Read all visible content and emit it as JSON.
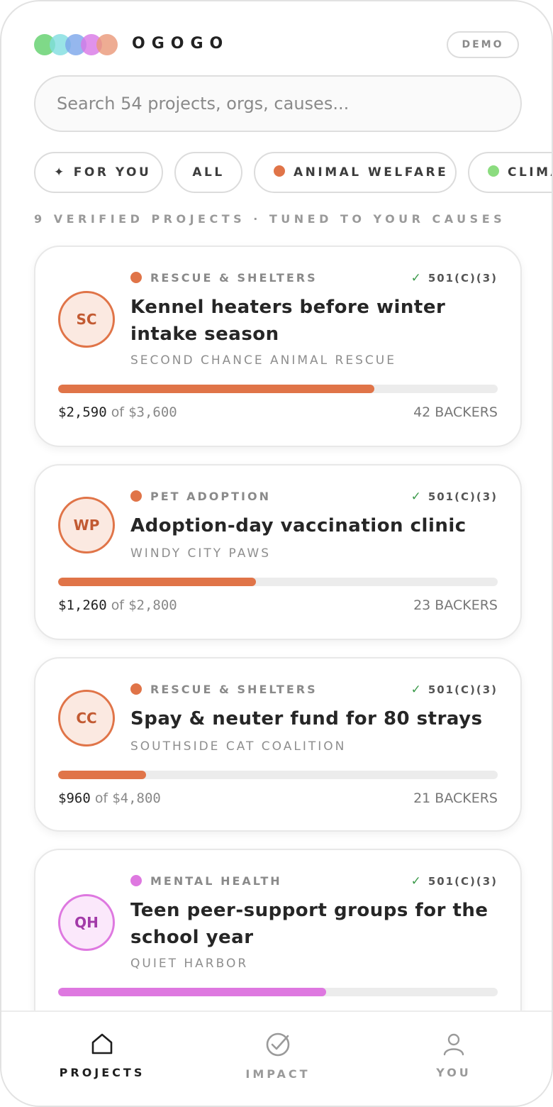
{
  "app": {
    "brand": "OGOGO",
    "demo_label": "DEMO"
  },
  "colors": {
    "logo_dots": [
      "#5fcf6a",
      "#7fdde0",
      "#7aa5ea",
      "#d877e6",
      "#ea9778"
    ],
    "animal": "#e07448",
    "climate": "#8bdc7f",
    "mental_health": "#de78e0",
    "verify_check": "#3c9a4b"
  },
  "search": {
    "placeholder": "Search 54 projects, orgs, causes..."
  },
  "chips": [
    {
      "label": "FOR YOU",
      "icon": "sparkle-icon",
      "active": true
    },
    {
      "label": "ALL"
    },
    {
      "label": "ANIMAL WELFARE",
      "dot": "animal"
    },
    {
      "label": "CLIMATE",
      "dot": "climate"
    }
  ],
  "list_summary": "9 VERIFIED PROJECTS · TUNED TO YOUR CAUSES",
  "projects": [
    {
      "initials": "SC",
      "category": "RESCUE & SHELTERS",
      "badge": "501(C)(3)",
      "title": "Kennel heaters before winter intake season",
      "org": "SECOND CHANCE ANIMAL RESCUE",
      "raised": "$2,590",
      "of": "of",
      "goal": "$3,600",
      "progress": 0.72,
      "backers": "42 BACKERS",
      "color": "animal"
    },
    {
      "initials": "WP",
      "category": "PET ADOPTION",
      "badge": "501(C)(3)",
      "title": "Adoption-day vaccination clinic",
      "org": "WINDY CITY PAWS",
      "raised": "$1,260",
      "of": "of",
      "goal": "$2,800",
      "progress": 0.45,
      "backers": "23 BACKERS",
      "color": "animal"
    },
    {
      "initials": "CC",
      "category": "RESCUE & SHELTERS",
      "badge": "501(C)(3)",
      "title": "Spay & neuter fund for 80 strays",
      "org": "SOUTHSIDE CAT COALITION",
      "raised": "$960",
      "of": "of",
      "goal": "$4,800",
      "progress": 0.2,
      "backers": "21 BACKERS",
      "color": "animal"
    },
    {
      "initials": "QH",
      "category": "MENTAL HEALTH",
      "badge": "501(C)(3)",
      "title": "Teen peer-support groups for the school year",
      "org": "QUIET HARBOR",
      "raised": "",
      "of": "",
      "goal": "",
      "progress": 0.61,
      "backers": "",
      "color": "mental_health"
    }
  ],
  "nav": [
    {
      "label": "PROJECTS",
      "icon": "home-icon",
      "active": true
    },
    {
      "label": "IMPACT",
      "icon": "check-circle-icon"
    },
    {
      "label": "YOU",
      "icon": "user-icon"
    }
  ]
}
